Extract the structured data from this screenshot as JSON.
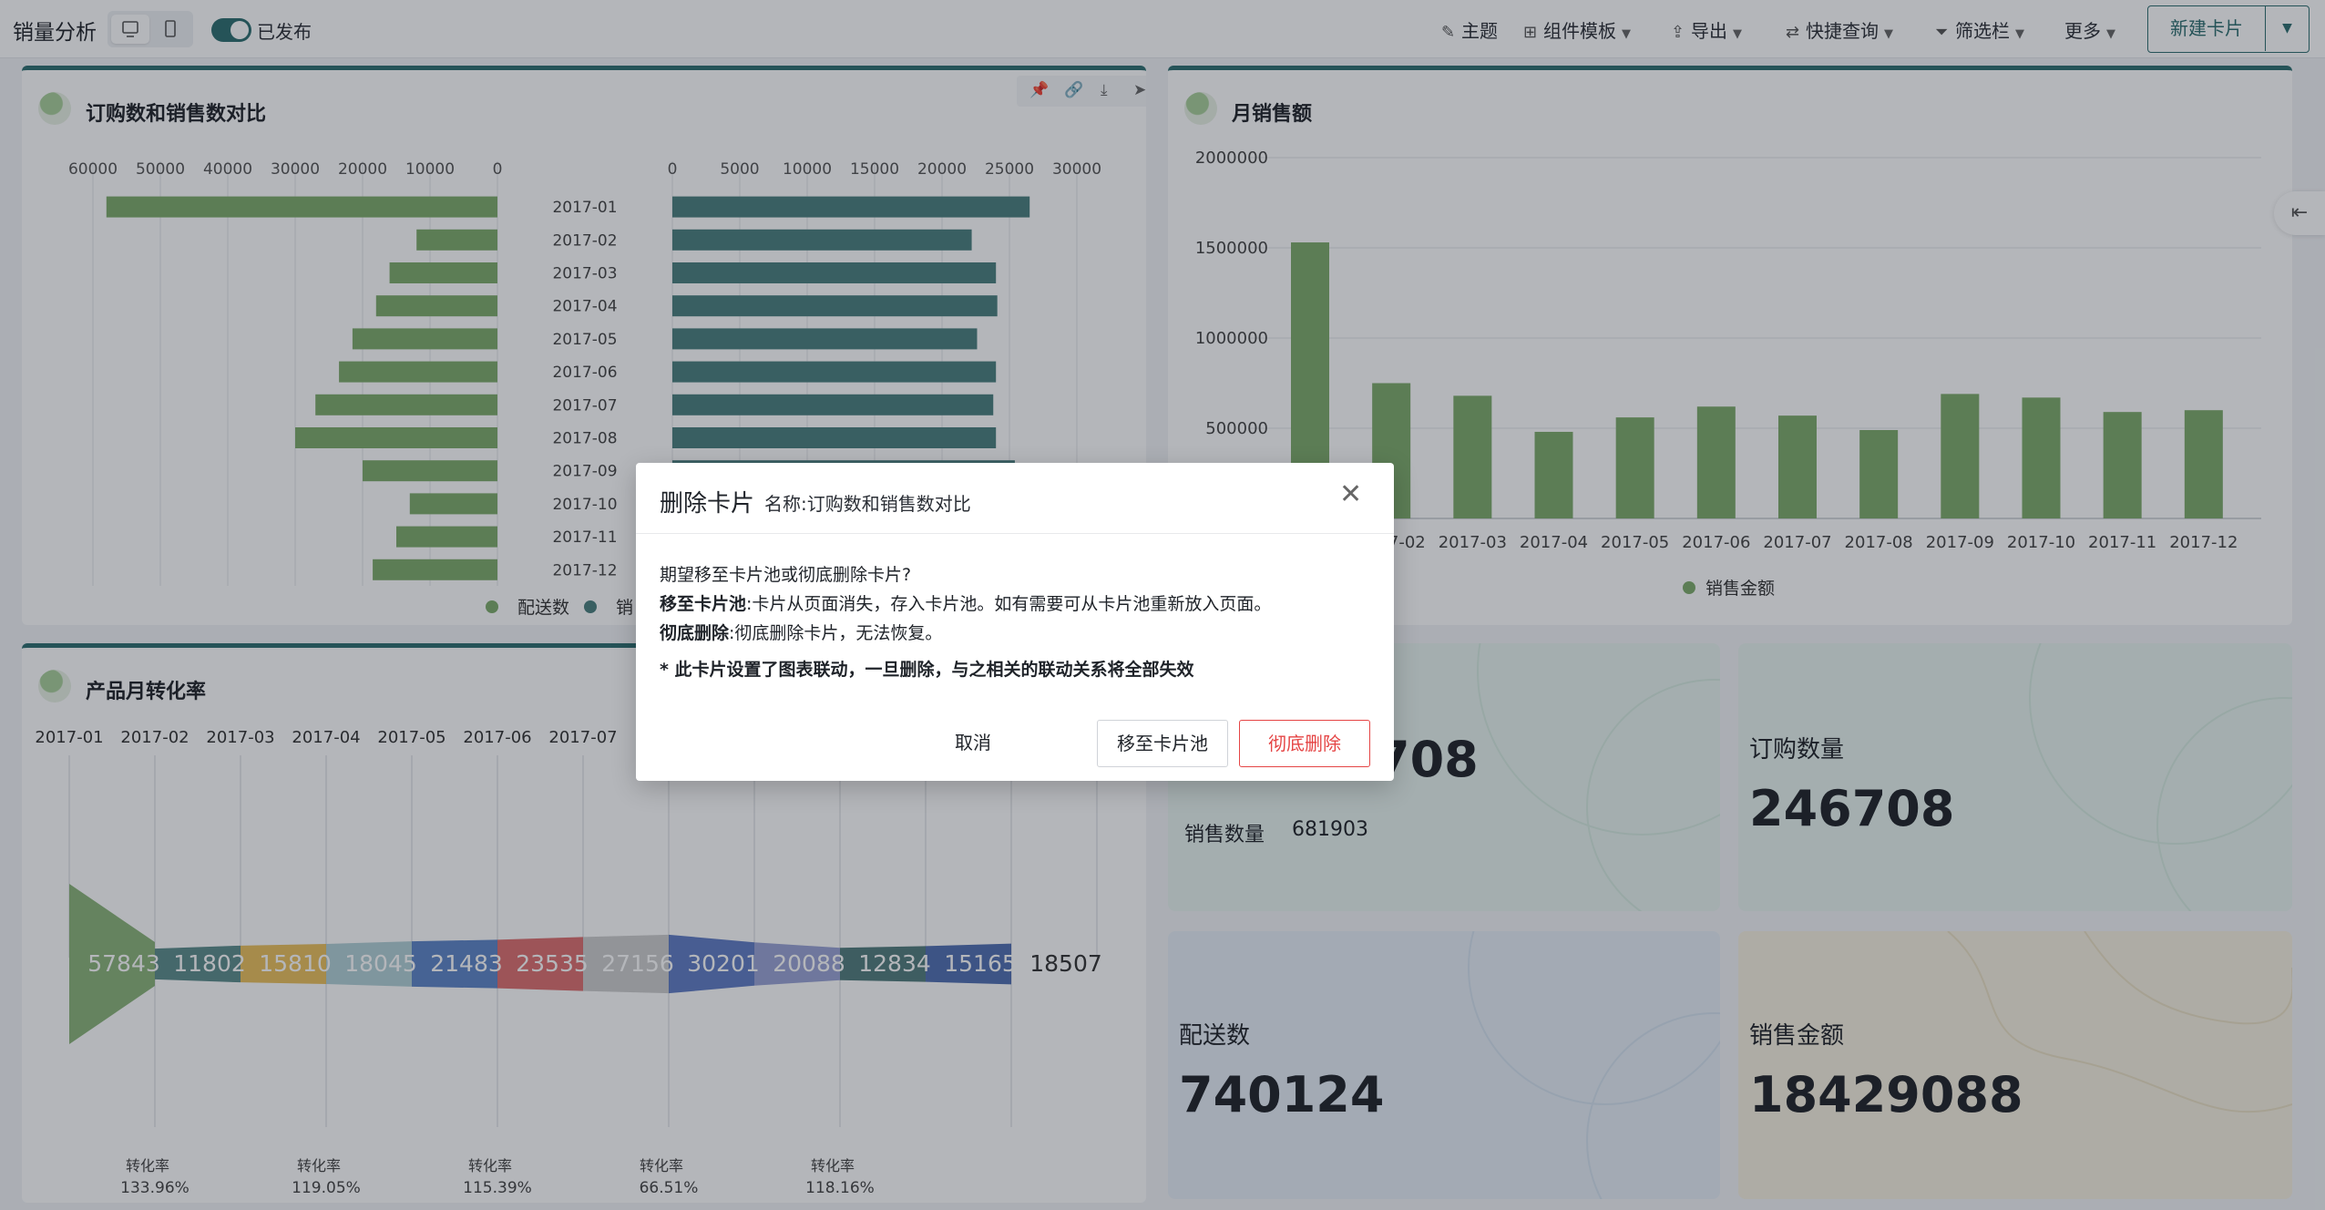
{
  "toolbar": {
    "title": "销量分析",
    "publish_label": "已发布",
    "theme": "主题",
    "templates": "组件模板",
    "export": "导出",
    "quick_query": "快捷查询",
    "filter_bar": "筛选栏",
    "more": "更多",
    "new_card": "新建卡片"
  },
  "icons": {
    "desktop": "desktop-icon",
    "mobile": "mobile-icon",
    "theme": "brush-icon",
    "templates": "grid-icon",
    "export": "export-icon",
    "quick_query": "sliders-icon",
    "filter": "funnel-icon",
    "pin": "pin-icon",
    "link": "link-icon",
    "download": "download-icon",
    "send": "send-icon",
    "side_panel": "outdent-icon"
  },
  "colors": {
    "primary": "#2d6e6f",
    "green_bar": "#7eac6a",
    "teal_bar": "#4a7f7e",
    "danger": "#e54545"
  },
  "cards": {
    "order_vs_sales": {
      "title": "订购数和销售数对比"
    },
    "monthly_sales": {
      "title": "月销售额"
    },
    "conversion": {
      "title": "产品月转化率"
    }
  },
  "kpis": {
    "sales_count": {
      "label": "销售数量",
      "value": "681903"
    },
    "order_count": {
      "label": "订购数量",
      "value": "246708"
    },
    "delivery_count": {
      "label": "配送数",
      "value": "740124"
    },
    "sales_amount": {
      "label": "销售金额",
      "value": "18429088"
    },
    "partial_value": "708"
  },
  "chart_data": [
    {
      "type": "bar",
      "title": "订购数和销售数对比",
      "categories": [
        "2017-01",
        "2017-02",
        "2017-03",
        "2017-04",
        "2017-05",
        "2017-06",
        "2017-07",
        "2017-08",
        "2017-09",
        "2017-10",
        "2017-11",
        "2017-12"
      ],
      "left_axis": {
        "ticks": [
          "60000",
          "50000",
          "40000",
          "30000",
          "20000",
          "10000",
          "0"
        ],
        "range": [
          0,
          60000
        ],
        "reversed": true
      },
      "right_axis": {
        "ticks": [
          "0",
          "5000",
          "10000",
          "15000",
          "20000",
          "25000",
          "30000"
        ],
        "range": [
          0,
          30000
        ]
      },
      "series": [
        {
          "name": "配送数",
          "color": "#7eac6a",
          "values": [
            58000,
            12000,
            16000,
            18000,
            21500,
            23500,
            27000,
            30000,
            20000,
            13000,
            15000,
            18500
          ]
        },
        {
          "name": "销",
          "color": "#4a7f7e",
          "values": [
            26500,
            22200,
            24000,
            24100,
            22600,
            24000,
            23800,
            24000,
            25400
          ]
        }
      ],
      "legend": "bottom",
      "grid": true
    },
    {
      "type": "bar",
      "title": "月销售额",
      "categories": [
        "2017-01",
        "2017-02",
        "2017-03",
        "2017-04",
        "2017-05",
        "2017-06",
        "2017-07",
        "2017-08",
        "2017-09",
        "2017-10",
        "2017-11",
        "2017-12"
      ],
      "tick_labels": [
        "2017-02",
        "2017-03",
        "2017-04",
        "2017-05",
        "2017-06",
        "2017-07",
        "2017-08",
        "2017-09",
        "2017-10",
        "2017-11",
        "2017-12"
      ],
      "yticks": [
        "2000000",
        "1500000",
        "1000000",
        "500000"
      ],
      "ylim": [
        0,
        2000000
      ],
      "series": [
        {
          "name": "销售金额",
          "color": "#7eac6a",
          "values": [
            1530000,
            750000,
            680000,
            480000,
            560000,
            620000,
            570000,
            490000,
            690000,
            670000,
            590000,
            600000
          ]
        }
      ],
      "legend": "bottom",
      "grid": true
    },
    {
      "type": "area",
      "subtype": "funnel-flow",
      "title": "产品月转化率",
      "categories": [
        "2017-01",
        "2017-02",
        "2017-03",
        "2017-04",
        "2017-05",
        "2017-06",
        "2017-07"
      ],
      "values": [
        57843,
        11802,
        15810,
        18045,
        21483,
        23535,
        27156,
        30201,
        20088,
        12834,
        15165,
        18507
      ],
      "value_labels": [
        "57843",
        "11802",
        "15810",
        "18045",
        "21483",
        "23535",
        "27156",
        "30201",
        "20088",
        "12834",
        "15165",
        "18507"
      ],
      "segment_colors": [
        "#7eac6a",
        "#4a7f7e",
        "#e8b94a",
        "#a9cbd2",
        "#4b78c2",
        "#d95f5f",
        "#c8c8c8",
        "#4f6fbf",
        "#8f99cf",
        "#3e6e6e",
        "#3d5fa8",
        "#ffffff"
      ],
      "conversion_label": "转化率",
      "conversion_rates": [
        "133.96%",
        "119.05%",
        "115.39%",
        "66.51%",
        "118.16%"
      ]
    }
  ],
  "legend_right_partial": "销",
  "modal": {
    "title": "删除卡片",
    "subtitle": "名称:订购数和销售数对比",
    "question": "期望移至卡片池或彻底删除卡片?",
    "move_term": "移至卡片池",
    "move_desc": ":卡片从页面消失，存入卡片池。如有需要可从卡片池重新放入页面。",
    "delete_term": "彻底删除",
    "delete_desc": ":彻底删除卡片，无法恢复。",
    "warning": "* 此卡片设置了图表联动，一旦删除，与之相关的联动关系将全部失效",
    "cancel": "取消",
    "move_btn": "移至卡片池",
    "delete_btn": "彻底删除"
  }
}
